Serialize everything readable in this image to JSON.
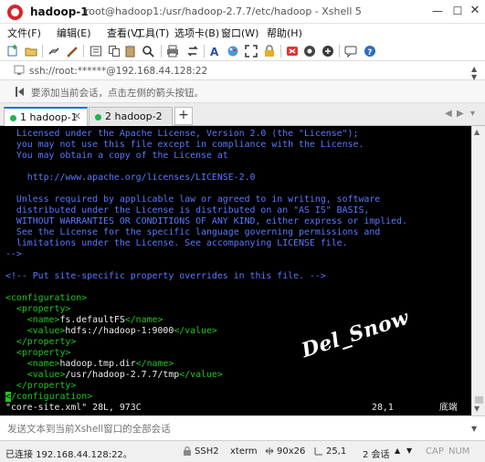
{
  "window": {
    "title_host": "hadoop-1",
    "title_path": "root@hadoop1:/usr/hadoop-2.7.7/etc/hadoop - Xshell 5",
    "min_label": "—",
    "max_label": "☐",
    "close_label": "✕"
  },
  "menu": [
    {
      "label": "文件(F)"
    },
    {
      "label": "编辑(E)"
    },
    {
      "label": "查看(V)"
    },
    {
      "label": "工具(T)"
    },
    {
      "label": "选项卡(B)"
    },
    {
      "label": "窗口(W)"
    },
    {
      "label": "帮助(H)"
    }
  ],
  "toolbar_icons": [
    "new-session-icon",
    "open-folder-icon",
    "disconnect-icon",
    "reconnect-icon",
    "properties-icon",
    "copy-icon",
    "paste-icon",
    "find-icon",
    "print-icon",
    "transfer-icon",
    "font-icon",
    "color-scheme-icon",
    "fullscreen-icon",
    "lock-icon",
    "xftp-icon",
    "xmanager-icon",
    "keyboard-icon",
    "chat-icon",
    "help-icon"
  ],
  "address": {
    "value": "ssh://root:******@192.168.44.128:22"
  },
  "info": {
    "text": "要添加当前会话，点击左侧的箭头按钮。"
  },
  "tabs": [
    {
      "label": "1 hadoop-1",
      "active": true
    },
    {
      "label": "2 hadoop-2",
      "active": false
    }
  ],
  "tab_add_label": "+",
  "tab_nav": {
    "prev": "◀",
    "next": "▶",
    "menu": "▾"
  },
  "terminal": {
    "lines": [
      {
        "cls": "c-comment",
        "text": "  Licensed under the Apache License, Version 2.0 (the \"License\");"
      },
      {
        "cls": "c-comment",
        "text": "  you may not use this file except in compliance with the License."
      },
      {
        "cls": "c-comment",
        "text": "  You may obtain a copy of the License at"
      },
      {
        "cls": "c-comment",
        "text": ""
      },
      {
        "cls": "c-comment",
        "text": "    http://www.apache.org/licenses/LICENSE-2.0"
      },
      {
        "cls": "c-comment",
        "text": ""
      },
      {
        "cls": "c-comment",
        "text": "  Unless required by applicable law or agreed to in writing, software"
      },
      {
        "cls": "c-comment",
        "text": "  distributed under the License is distributed on an \"AS IS\" BASIS,"
      },
      {
        "cls": "c-comment",
        "text": "  WITHOUT WARRANTIES OR CONDITIONS OF ANY KIND, either express or implied."
      },
      {
        "cls": "c-comment",
        "text": "  See the License for the specific language governing permissions and"
      },
      {
        "cls": "c-comment",
        "text": "  limitations under the License. See accompanying LICENSE file."
      },
      {
        "cls": "c-comment",
        "text": "-->"
      },
      {
        "cls": "c-comment",
        "text": ""
      },
      {
        "cls": "c-comment",
        "text": "<!-- Put site-specific property overrides in this file. -->"
      },
      {
        "cls": "c-comment",
        "text": ""
      },
      {
        "cls": "c-tag",
        "text": "<configuration>"
      },
      {
        "cls": "c-tag",
        "text": "  <property>"
      },
      {
        "cls": "mixed",
        "parts": [
          {
            "cls": "c-tag",
            "text": "    <name>"
          },
          {
            "cls": "c-text",
            "text": "fs.defaultFS"
          },
          {
            "cls": "c-tag",
            "text": "</name>"
          }
        ]
      },
      {
        "cls": "mixed",
        "parts": [
          {
            "cls": "c-tag",
            "text": "    <value>"
          },
          {
            "cls": "c-text",
            "text": "hdfs://hadoop-1:9000"
          },
          {
            "cls": "c-tag",
            "text": "</value>"
          }
        ]
      },
      {
        "cls": "c-tag",
        "text": "  </property>"
      },
      {
        "cls": "c-tag",
        "text": "  <property>"
      },
      {
        "cls": "mixed",
        "parts": [
          {
            "cls": "c-tag",
            "text": "    <name>"
          },
          {
            "cls": "c-text",
            "text": "hadoop.tmp.dir"
          },
          {
            "cls": "c-tag",
            "text": "</name>"
          }
        ]
      },
      {
        "cls": "mixed",
        "parts": [
          {
            "cls": "c-tag",
            "text": "    <value>"
          },
          {
            "cls": "c-text",
            "text": "/usr/hadoop-2.7.7/tmp"
          },
          {
            "cls": "c-tag",
            "text": "</value>"
          }
        ]
      },
      {
        "cls": "c-tag",
        "text": "  </property>"
      },
      {
        "cls": "mixed",
        "parts": [
          {
            "cls": "cursor-cell",
            "text": "<"
          },
          {
            "cls": "c-tag",
            "text": "/configuration>"
          }
        ]
      }
    ],
    "status_file": "\"core-site.xml\" 28L, 973C",
    "status_pos": "28,1",
    "status_where": "底端",
    "watermark": "Del_Snow"
  },
  "send_bar": {
    "placeholder": "发送文本到当前Xshell窗口的全部会话"
  },
  "statusbar": {
    "connection": "已连接 192.168.44.128:22。",
    "protocol": "SSH2",
    "terminal_type": "xterm",
    "size": "90x26",
    "cursor": "25,1",
    "sessions": "2 会话",
    "caps": "CAP",
    "num": "NUM"
  }
}
